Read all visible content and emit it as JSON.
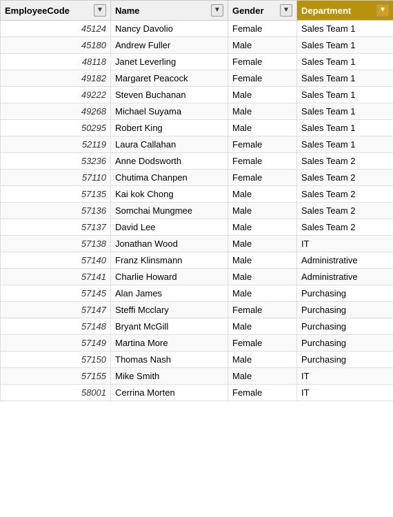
{
  "table": {
    "columns": [
      {
        "id": "empcode",
        "label": "EmployeeCode",
        "sort": false
      },
      {
        "id": "name",
        "label": "Name",
        "sort": false
      },
      {
        "id": "gender",
        "label": "Gender",
        "sort": false
      },
      {
        "id": "department",
        "label": "Department",
        "sort": true
      }
    ],
    "rows": [
      {
        "empcode": "45124",
        "name": "Nancy Davolio",
        "gender": "Female",
        "department": "Sales Team 1"
      },
      {
        "empcode": "45180",
        "name": "Andrew Fuller",
        "gender": "Male",
        "department": "Sales Team 1"
      },
      {
        "empcode": "48118",
        "name": "Janet Leverling",
        "gender": "Female",
        "department": "Sales Team 1"
      },
      {
        "empcode": "49182",
        "name": "Margaret Peacock",
        "gender": "Female",
        "department": "Sales Team 1"
      },
      {
        "empcode": "49222",
        "name": "Steven Buchanan",
        "gender": "Male",
        "department": "Sales Team 1"
      },
      {
        "empcode": "49268",
        "name": "Michael Suyama",
        "gender": "Male",
        "department": "Sales Team 1"
      },
      {
        "empcode": "50295",
        "name": "Robert King",
        "gender": "Male",
        "department": "Sales Team 1"
      },
      {
        "empcode": "52119",
        "name": "Laura Callahan",
        "gender": "Female",
        "department": "Sales Team 1"
      },
      {
        "empcode": "53236",
        "name": "Anne Dodsworth",
        "gender": "Female",
        "department": "Sales Team 2"
      },
      {
        "empcode": "57110",
        "name": "Chutima Chanpen",
        "gender": "Female",
        "department": "Sales Team 2"
      },
      {
        "empcode": "57135",
        "name": "Kai kok Chong",
        "gender": "Male",
        "department": "Sales Team 2"
      },
      {
        "empcode": "57136",
        "name": "Somchai Mungmee",
        "gender": "Male",
        "department": "Sales Team 2"
      },
      {
        "empcode": "57137",
        "name": "David Lee",
        "gender": "Male",
        "department": "Sales Team 2"
      },
      {
        "empcode": "57138",
        "name": "Jonathan Wood",
        "gender": "Male",
        "department": "IT"
      },
      {
        "empcode": "57140",
        "name": "Franz Klinsmann",
        "gender": "Male",
        "department": "Administrative"
      },
      {
        "empcode": "57141",
        "name": "Charlie Howard",
        "gender": "Male",
        "department": "Administrative"
      },
      {
        "empcode": "57145",
        "name": "Alan James",
        "gender": "Male",
        "department": "Purchasing"
      },
      {
        "empcode": "57147",
        "name": "Steffi Mcclary",
        "gender": "Female",
        "department": "Purchasing"
      },
      {
        "empcode": "57148",
        "name": "Bryant McGill",
        "gender": "Male",
        "department": "Purchasing"
      },
      {
        "empcode": "57149",
        "name": "Martina More",
        "gender": "Female",
        "department": "Purchasing"
      },
      {
        "empcode": "57150",
        "name": "Thomas Nash",
        "gender": "Male",
        "department": "Purchasing"
      },
      {
        "empcode": "57155",
        "name": "Mike Smith",
        "gender": "Male",
        "department": "IT"
      },
      {
        "empcode": "58001",
        "name": "Cerrina Morten",
        "gender": "Female",
        "department": "IT"
      }
    ]
  }
}
